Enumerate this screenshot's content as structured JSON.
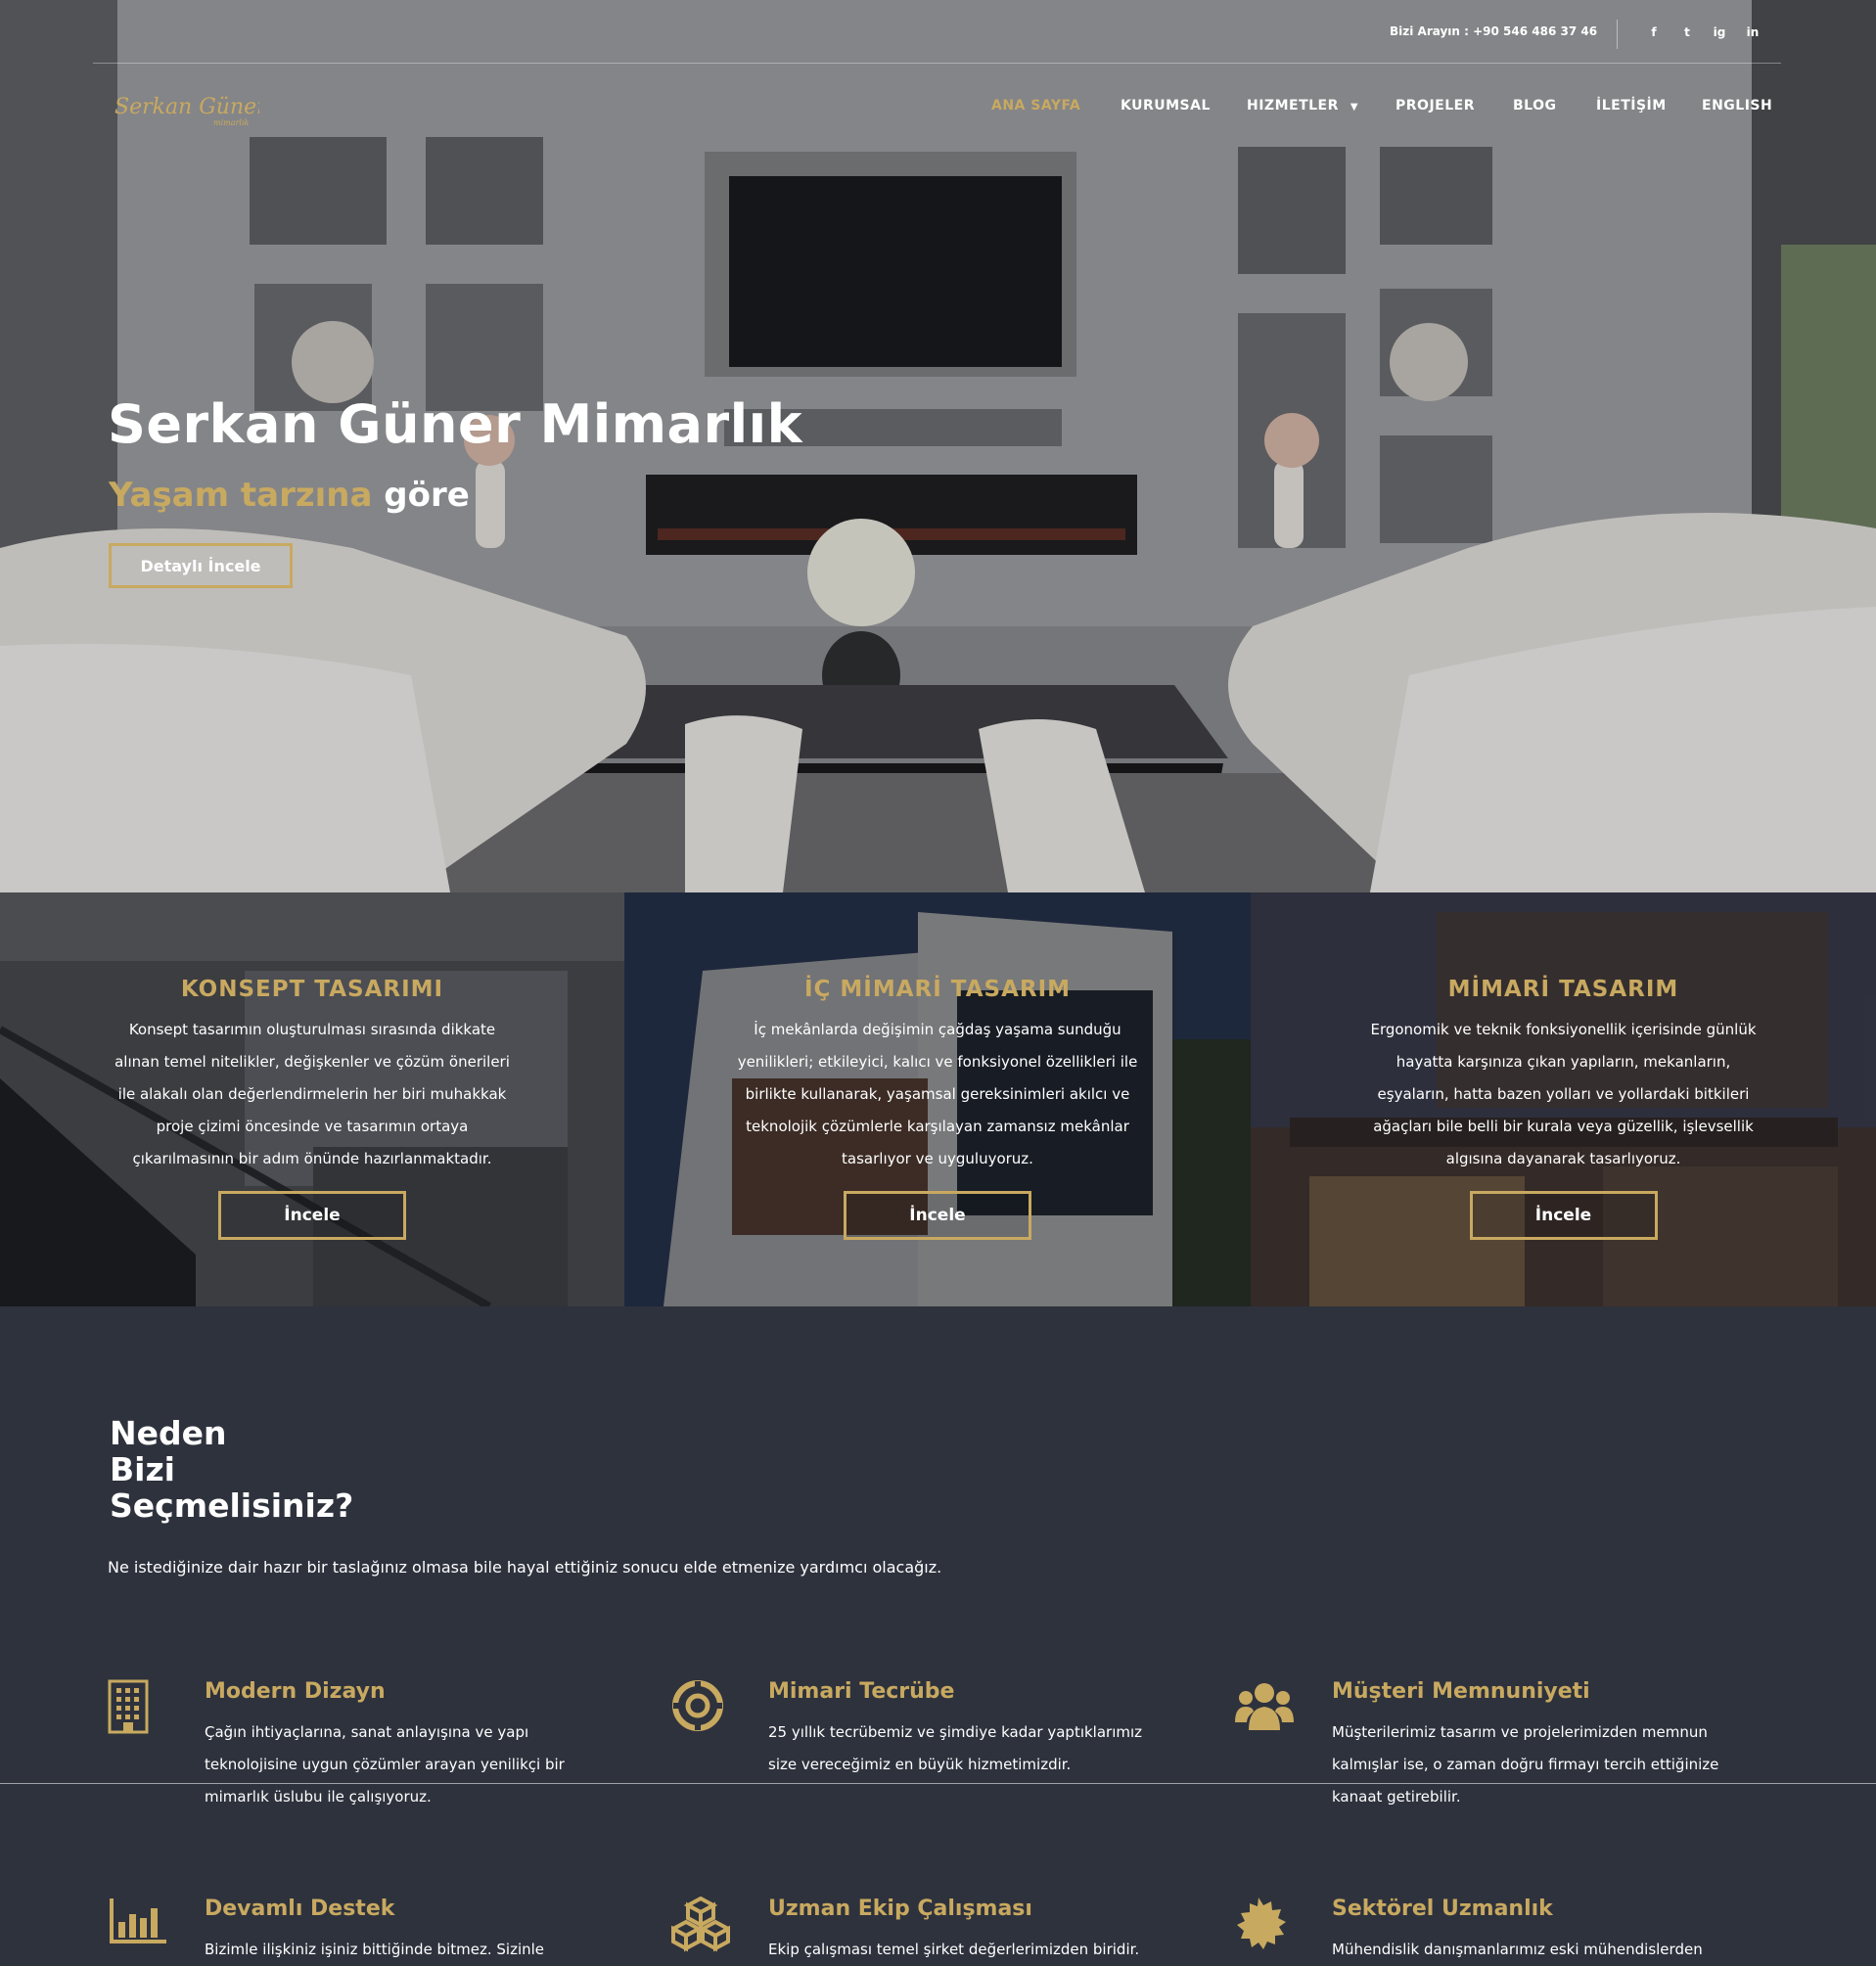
{
  "header": {
    "phone_text": "Bizi Arayın : +90 546 486 37 46",
    "social": [
      "f",
      "t",
      "ig",
      "in"
    ],
    "social_icons": [
      "facebook-icon",
      "twitter-icon",
      "instagram-icon",
      "linkedin-icon"
    ],
    "logo_text": "Serkan Güner",
    "logo_subtext": "mimarlık",
    "nav": [
      {
        "label": "ANA SAYFA",
        "active": true
      },
      {
        "label": "KURUMSAL",
        "active": false
      },
      {
        "label": "HIZMETLER",
        "active": false,
        "dropdown": true
      },
      {
        "label": "PROJELER",
        "active": false
      },
      {
        "label": "BLOG",
        "active": false
      },
      {
        "label": "İLETİŞİM",
        "active": false
      },
      {
        "label": "ENGLISH",
        "active": false
      }
    ]
  },
  "hero": {
    "title": "Serkan Güner Mimarlık",
    "subtitle_gold": "Yaşam tarzına",
    "subtitle_white": "göre",
    "button": "Detaylı İncele"
  },
  "services": [
    {
      "title": "KONSEPT TASARIMI",
      "text": "Konsept tasarımın oluşturulması sırasında dikkate alınan temel nitelikler, değişkenler ve çözüm önerileri ile alakalı olan değerlendirmelerin her biri muhakkak proje çizimi öncesinde ve tasarımın ortaya çıkarılmasının bir adım önünde hazırlanmaktadır.",
      "button": "İncele"
    },
    {
      "title": "İÇ MİMARİ TASARIM",
      "text": "İç mekânlarda değişimin çağdaş yaşama sunduğu yenilikleri; etkileyici, kalıcı ve fonksiyonel özellikleri ile birlikte kullanarak, yaşamsal gereksinimleri akılcı ve teknolojik çözümlerle karşılayan zamansız mekânlar tasarlıyor ve uyguluyoruz.",
      "button": "İncele"
    },
    {
      "title": "MİMARİ TASARIM",
      "text": "Ergonomik ve teknik fonksiyonellik içerisinde günlük hayatta karşınıza çıkan yapıların, mekanların, eşyaların, hatta bazen yolları ve yollardaki bitkileri ağaçları bile belli bir kurala veya güzellik, işlevsellik algısına dayanarak tasarlıyoruz.",
      "button": "İncele"
    }
  ],
  "why": {
    "title_lines": [
      "Neden",
      "Bizi",
      "Seçmelisiniz?"
    ],
    "subtitle": "Ne istediğinize dair hazır bir taslağınız olmasa bile hayal ettiğiniz sonucu elde etmenize yardımcı olacağız.",
    "features": [
      {
        "title": "Modern Dizayn",
        "icon": "building-icon",
        "text": "Çağın ihtiyaçlarına, sanat anlayışına ve yapı teknolojisine uygun çözümler arayan yenilikçi bir mimarlık üslubu ile çalışıyoruz."
      },
      {
        "title": "Mimari Tecrübe",
        "icon": "lifebuoy-icon",
        "text": "25 yıllık tecrübemiz ve şimdiye kadar yaptıklarımız size vereceğimiz en büyük hizmetimizdir."
      },
      {
        "title": "Müşteri Memnuniyeti",
        "icon": "users-icon",
        "text": "Müşterilerimiz tasarım ve projelerimizden memnun kalmışlar ise, o zaman doğru firmayı tercih ettiğinize kanaat getirebilir."
      },
      {
        "title": "Devamlı Destek",
        "icon": "bar-chart-icon",
        "text": "Bizimle ilişkiniz işiniz bittiğinde bitmez. Sizinle"
      },
      {
        "title": "Uzman Ekip Çalışması",
        "icon": "cubes-icon",
        "text": "Ekip çalışması temel şirket değerlerimizden biridir."
      },
      {
        "title": "Sektörel Uzmanlık",
        "icon": "certificate-icon",
        "text": "Mühendislik danışmanlarımız eski mühendislerden"
      }
    ]
  },
  "colors": {
    "accent": "#c8a960",
    "background": "#2e323d",
    "text": "#ffffff"
  }
}
